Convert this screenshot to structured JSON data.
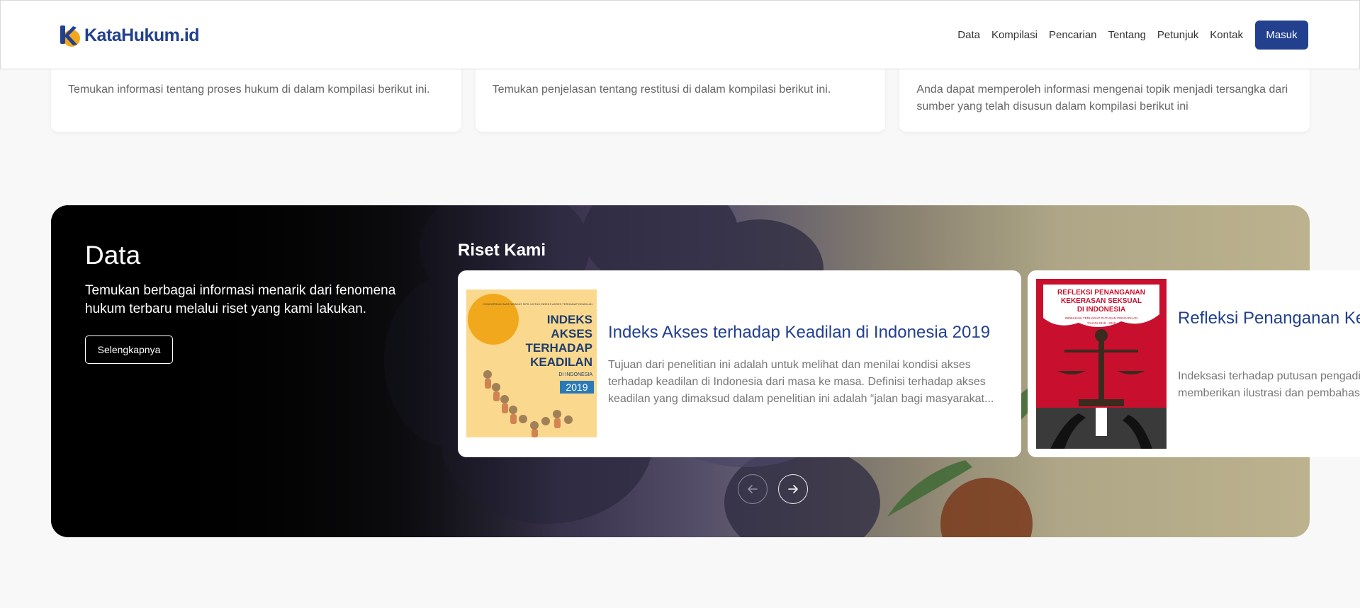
{
  "header": {
    "logo_text": "KataHukum.id",
    "nav": [
      "Data",
      "Kompilasi",
      "Pencarian",
      "Tentang",
      "Petunjuk",
      "Kontak"
    ],
    "login_label": "Masuk"
  },
  "cards": [
    {
      "text": "Temukan informasi tentang proses hukum di dalam kompilasi berikut ini."
    },
    {
      "text": "Temukan penjelasan tentang restitusi di dalam kompilasi berikut ini."
    },
    {
      "text": "Anda dapat memperoleh informasi mengenai topik menjadi tersangka dari sumber yang telah disusun dalam kompilasi berikut ini"
    }
  ],
  "banner": {
    "title": "Data",
    "description": "Temukan berbagai informasi menarik dari fenomena hukum terbaru melalui riset yang kami lakukan.",
    "more_label": "Selengkapnya",
    "riset_title": "Riset Kami"
  },
  "research": [
    {
      "title": "Indeks Akses terhadap Keadilan di Indonesia 2019",
      "description": "Tujuan dari penelitian ini adalah untuk melihat dan menilai kondisi akses terhadap keadilan di Indonesia dari masa ke masa. Definisi terhadap akses keadilan yang dimaksud dalam penelitian ini adalah “jalan bagi masyarakat...",
      "cover_small": "KONSORSIUM MASYARAKAT SIPIL UNTUK INDEKS AKSES TERHADAP KEADILAN",
      "cover_lines": [
        "INDEKS",
        "AKSES",
        "TERHADAP",
        "KEADILAN"
      ],
      "cover_sub": "DI INDONESIA",
      "cover_year": "2019"
    },
    {
      "title": "Refleksi Penanganan Kekerasan Seksual di Indonesia",
      "description": "Indeksasi terhadap putusan pengadilan kekerasan seksual yang diselesaikan dan memberikan ilustrasi dan pembahasan",
      "cover_lines": [
        "REFLEKSI PENANGANAN",
        "KEKERASAN SEKSUAL",
        "DI INDONESIA"
      ],
      "cover_sub": "INDEKSASI TERHADAP PUTUSAN PENGADILAN",
      "cover_year": "TAHUN 2018 - 2020"
    }
  ],
  "colors": {
    "brand": "#22408e",
    "accent": "#f2a81d",
    "cover2": "#c8102e"
  },
  "icons": {
    "prev": "arrow-left-icon",
    "next": "arrow-right-icon"
  }
}
